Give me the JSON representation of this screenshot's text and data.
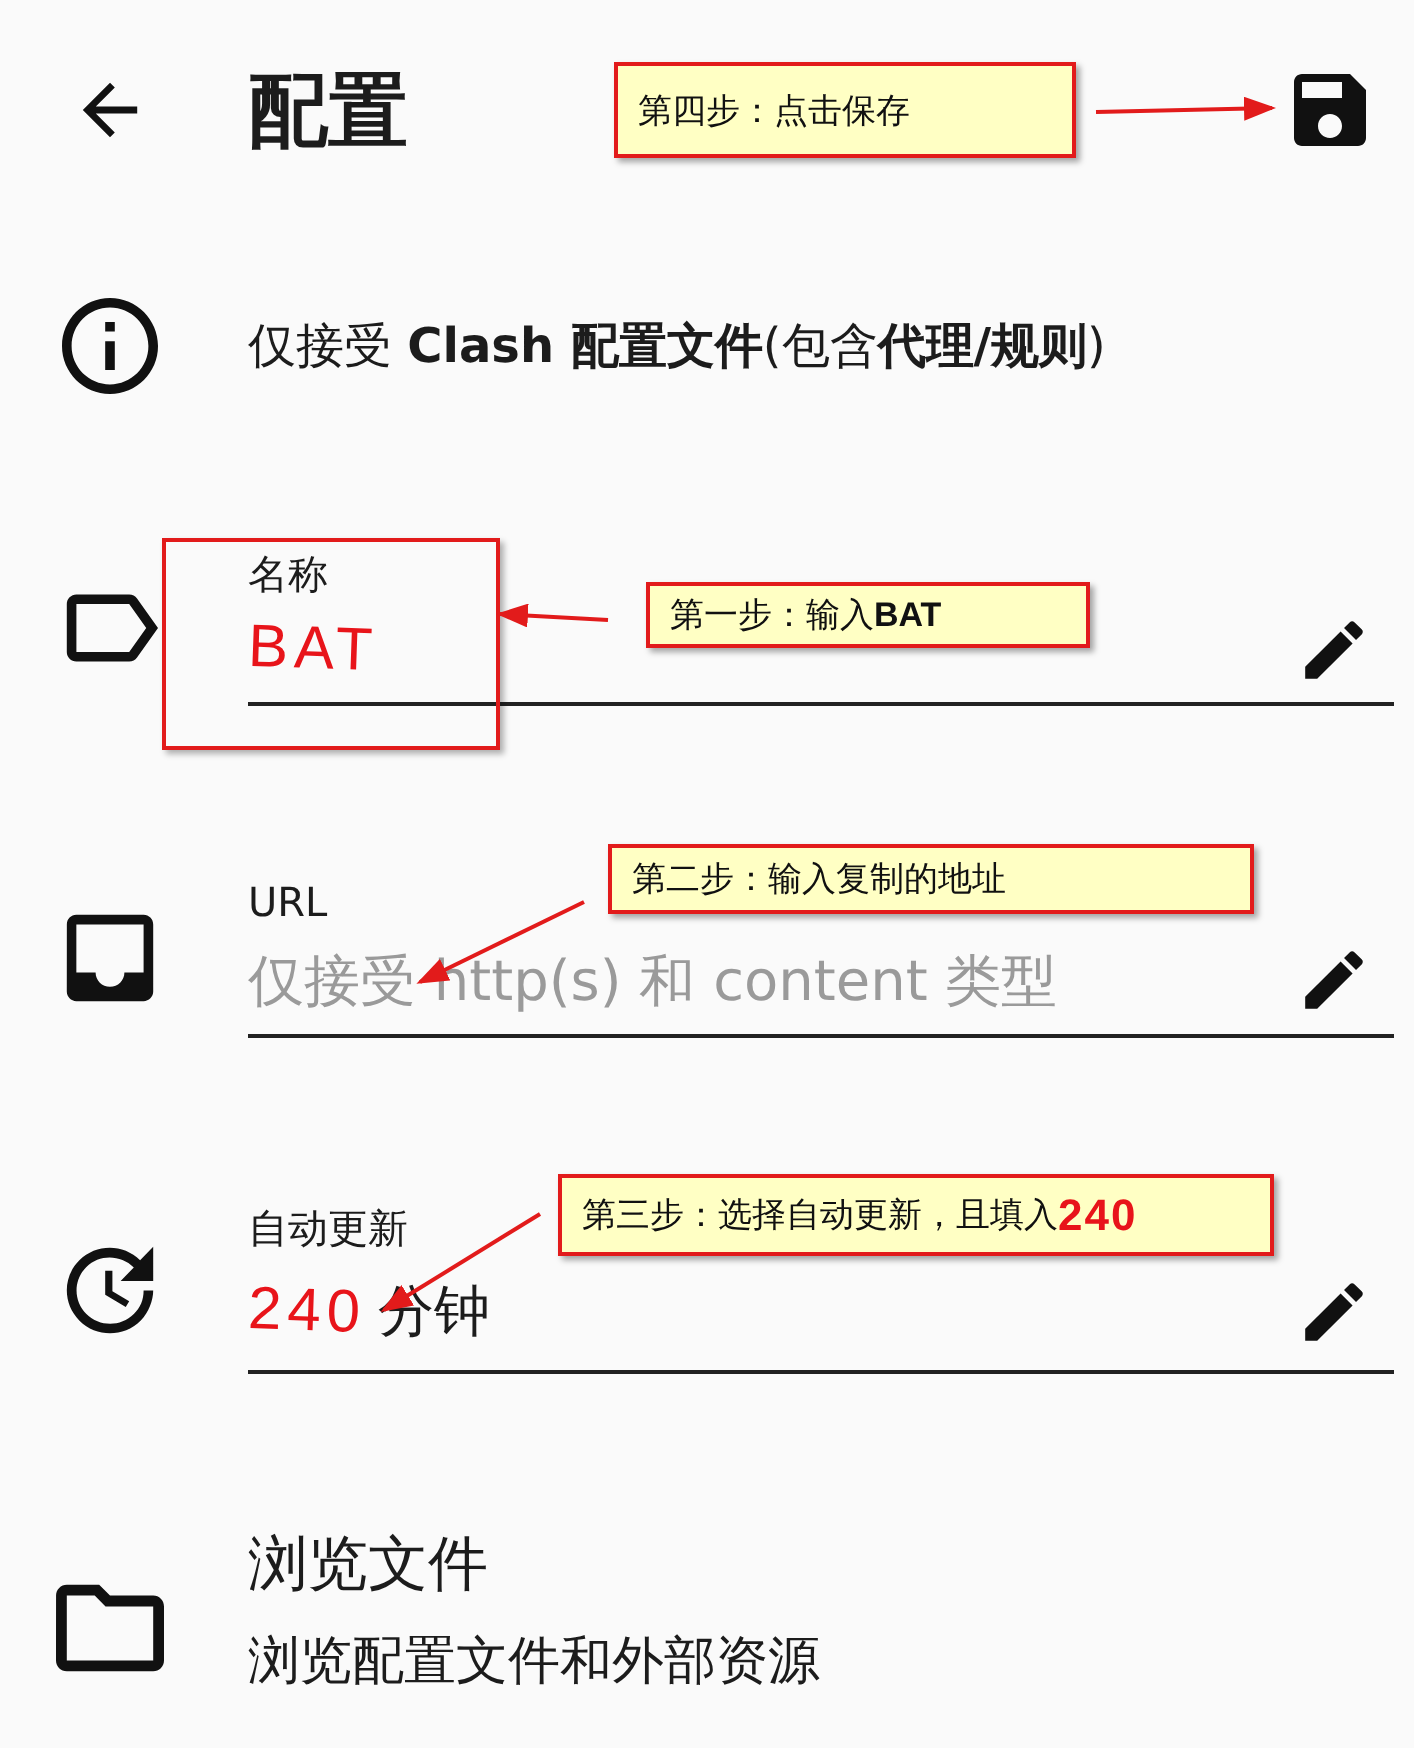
{
  "header": {
    "title": "配置"
  },
  "info": {
    "text": "仅接受 **Clash 配置文件**(包含**代理/规则**)"
  },
  "fields": [
    {
      "label": "名称",
      "value": "BAT",
      "highlighted": true
    },
    {
      "label": "URL",
      "placeholder": "仅接受 http(s) 和 content 类型",
      "highlighted": false
    },
    {
      "label": "自动更新",
      "value": "240",
      "unit": "分钟",
      "highlighted": false
    }
  ],
  "browse": {
    "title": "浏览文件",
    "subtitle": "浏览配置文件和外部资源"
  },
  "callouts": [
    {
      "text": "第四步：点击保存"
    },
    {
      "text": "第一步：输入**BAT**"
    },
    {
      "text": "第二步：输入复制的地址"
    },
    {
      "text": "第三步：选择自动更新，且填入",
      "note": "240"
    }
  ]
}
